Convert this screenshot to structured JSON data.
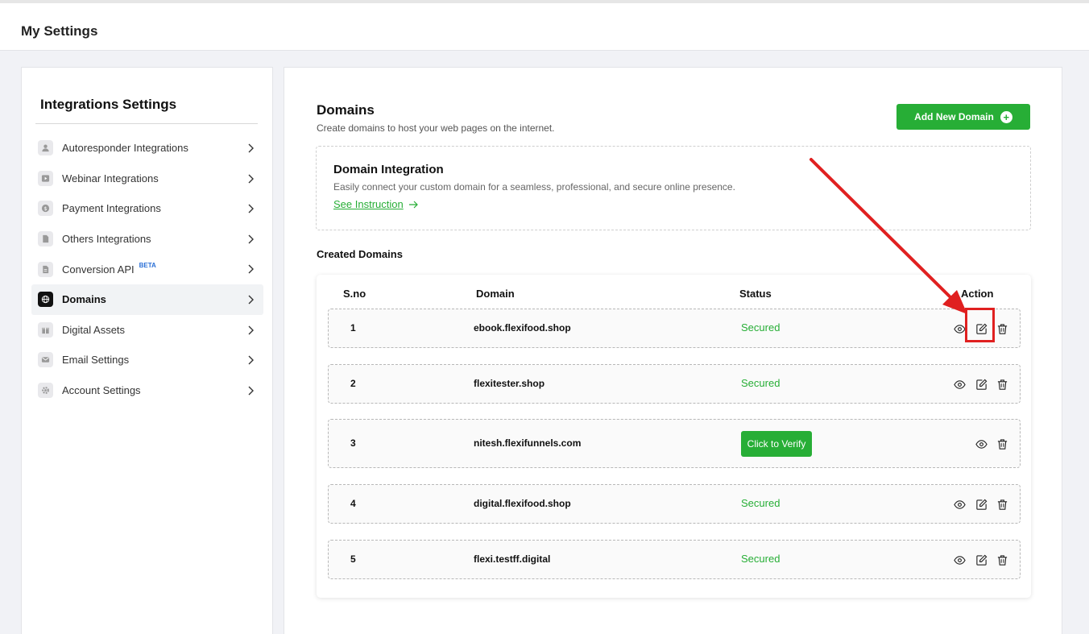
{
  "header": {
    "title": "My Settings"
  },
  "sidebar": {
    "title": "Integrations Settings",
    "items": [
      {
        "label": "Autoresponder Integrations",
        "icon": "user-icon"
      },
      {
        "label": "Webinar Integrations",
        "icon": "video-icon"
      },
      {
        "label": "Payment Integrations",
        "icon": "dollar-icon"
      },
      {
        "label": "Others Integrations",
        "icon": "document-icon"
      },
      {
        "label": "Conversion API",
        "badge": "BETA",
        "icon": "file-icon"
      },
      {
        "label": "Domains",
        "icon": "globe-icon",
        "active": true
      },
      {
        "label": "Digital Assets",
        "icon": "gift-icon"
      },
      {
        "label": "Email Settings",
        "icon": "mail-icon"
      },
      {
        "label": "Account Settings",
        "icon": "gear-icon"
      }
    ]
  },
  "main": {
    "title": "Domains",
    "subtitle": "Create domains to host your web pages on the internet.",
    "add_button": "Add New Domain",
    "integration": {
      "title": "Domain Integration",
      "description": "Easily connect your custom domain for a seamless, professional, and secure online presence.",
      "link": "See Instruction"
    },
    "created_label": "Created Domains",
    "table": {
      "headers": {
        "sno": "S.no",
        "domain": "Domain",
        "status": "Status",
        "action": "Action"
      },
      "rows": [
        {
          "sno": "1",
          "domain": "ebook.flexifood.shop",
          "status": "Secured"
        },
        {
          "sno": "2",
          "domain": "flexitester.shop",
          "status": "Secured"
        },
        {
          "sno": "3",
          "domain": "nitesh.flexifunnels.com",
          "verify": "Click to Verify"
        },
        {
          "sno": "4",
          "domain": "digital.flexifood.shop",
          "status": "Secured"
        },
        {
          "sno": "5",
          "domain": "flexi.testff.digital",
          "status": "Secured"
        }
      ]
    }
  },
  "colors": {
    "accent": "#27ae36",
    "annotation": "#e02020"
  }
}
